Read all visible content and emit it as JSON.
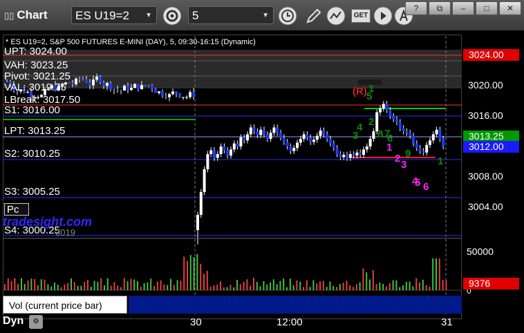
{
  "app": {
    "title": "Chart"
  },
  "toolbar": {
    "symbol": "ES U19=2",
    "interval": "5",
    "get_badge": "GET"
  },
  "window_buttons": [
    "?",
    "⧉",
    "–",
    "□",
    "✕"
  ],
  "chart": {
    "subtitle": "* ES U19=2, S&P 500 FUTURES E-MINI (DAY), 5, 09:30-16:15 (Dynamic)",
    "levels": [
      {
        "label": "UPT: 3024.00",
        "price": 3024.0,
        "color": "#ff3333"
      },
      {
        "label": "VAH: 3023.25",
        "price": 3023.25,
        "color": "#ffffff"
      },
      {
        "label": "Pivot: 3021.25",
        "price": 3021.25,
        "color": "#ffffff"
      },
      {
        "label": "VAL: 3019.75",
        "price": 3019.75,
        "color": "#ffffff"
      },
      {
        "label": "LBreak: 3017.50",
        "price": 3017.5,
        "color": "#ff3333"
      },
      {
        "label": "S1: 3016.00",
        "price": 3016.0,
        "color": "#2b2bff"
      },
      {
        "label": "LPT: 3013.25",
        "price": 3013.25,
        "color": "#9a9aff"
      },
      {
        "label": "S2: 3010.25",
        "price": 3010.25,
        "color": "#2b2bff"
      },
      {
        "label": "S3: 3005.25",
        "price": 3005.25,
        "color": "#2b2bff"
      },
      {
        "label": "S4: 3000.25",
        "price": 3000.25,
        "color": "#2b2bff"
      }
    ],
    "price_axis": [
      "3024.00",
      "3020.00",
      "3016.00",
      "3013.25",
      "3012.00",
      "3008.00",
      "3004.00"
    ],
    "price_tags": [
      {
        "value": "3024.00",
        "color": "#e00000"
      },
      {
        "value": "3013.25",
        "color": "#009900"
      },
      {
        "value": "3012.00",
        "color": "#1a1aff"
      }
    ],
    "time_axis": [
      "30",
      "12:00",
      "31"
    ],
    "pc_label": "Pc",
    "watermark": "tradesight.com",
    "obscured_text": "3019",
    "annotations": {
      "r_label": "(R)",
      "counts_green": [
        "1",
        "2",
        "3",
        "4",
        "5",
        "6",
        "7",
        "8",
        "9",
        "1"
      ],
      "counts_magenta": [
        "1",
        "2",
        "3",
        "4",
        "5",
        "6"
      ]
    }
  },
  "volume": {
    "label": "Vol (current price bar)",
    "axis": [
      "50000",
      "0"
    ],
    "current": "9376"
  },
  "footer": {
    "label": "Dyn"
  }
}
